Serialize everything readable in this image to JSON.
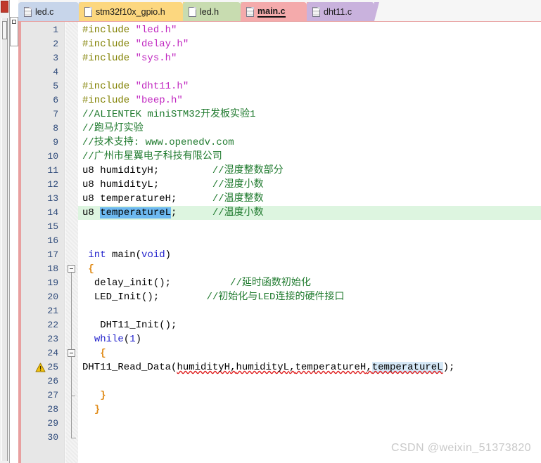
{
  "window": {
    "rail_button_color": "#c0392b",
    "accent_border_color": "#e8a0a0"
  },
  "tabs": [
    {
      "label": "led.c",
      "color": "#c7d5ea",
      "active": false,
      "icon": "file-lines-icon"
    },
    {
      "label": "stm32f10x_gpio.h",
      "color": "#fcd77f",
      "active": false,
      "icon": "file-blank-icon"
    },
    {
      "label": "led.h",
      "color": "#c8dcb0",
      "active": false,
      "icon": "file-blank-icon"
    },
    {
      "label": "main.c",
      "color": "#f4aaab",
      "active": true,
      "icon": "file-lines-icon"
    },
    {
      "label": "dht11.c",
      "color": "#c9b2dd",
      "active": false,
      "icon": "file-lines-icon"
    }
  ],
  "editor": {
    "current_line": 14,
    "selected_word": "temperatureL",
    "warning_line": 25,
    "warning_icon": "warning-triangle-icon",
    "colors": {
      "preprocessor": "#808000",
      "string": "#c026c0",
      "comment": "#1f7a2e",
      "keyword": "#2323cc",
      "brace": "#e08a16",
      "line_number": "#2e4a7a",
      "current_line_bg": "#ddf5e0",
      "selection_bg": "#6db9f0",
      "word_highlight_bg": "#d5e8f7",
      "error_squiggle": "#e02020",
      "gutter_bg": "#e7e7e7"
    },
    "lines": [
      {
        "n": 1,
        "text": "#include \"led.h\""
      },
      {
        "n": 2,
        "text": "#include \"delay.h\""
      },
      {
        "n": 3,
        "text": "#include \"sys.h\""
      },
      {
        "n": 4,
        "text": ""
      },
      {
        "n": 5,
        "text": "#include \"dht11.h\""
      },
      {
        "n": 6,
        "text": "#include \"beep.h\""
      },
      {
        "n": 7,
        "text": "//ALIENTEK miniSTM32开发板实验1"
      },
      {
        "n": 8,
        "text": "//跑马灯实验"
      },
      {
        "n": 9,
        "text": "//技术支持: www.openedv.com"
      },
      {
        "n": 10,
        "text": "//广州市星翼电子科技有限公司"
      },
      {
        "n": 11,
        "text": "u8 humidityH;         //湿度整数部分"
      },
      {
        "n": 12,
        "text": "u8 humidityL;         //湿度小数"
      },
      {
        "n": 13,
        "text": "u8 temperatureH;      //温度整数"
      },
      {
        "n": 14,
        "text": "u8 temperatureL;      //温度小数"
      },
      {
        "n": 15,
        "text": ""
      },
      {
        "n": 16,
        "text": ""
      },
      {
        "n": 17,
        "text": " int main(void)"
      },
      {
        "n": 18,
        "text": " {"
      },
      {
        "n": 19,
        "text": "  delay_init();          //延时函数初始化"
      },
      {
        "n": 20,
        "text": "  LED_Init();        //初始化与LED连接的硬件接口"
      },
      {
        "n": 21,
        "text": ""
      },
      {
        "n": 22,
        "text": "   DHT11_Init();"
      },
      {
        "n": 23,
        "text": "  while(1)"
      },
      {
        "n": 24,
        "text": "   {"
      },
      {
        "n": 25,
        "text": "DHT11_Read_Data(humidityH,humidityL,temperatureH,temperatureL);"
      },
      {
        "n": 26,
        "text": ""
      },
      {
        "n": 27,
        "text": "   }"
      },
      {
        "n": 28,
        "text": "  }"
      },
      {
        "n": 29,
        "text": ""
      },
      {
        "n": 30,
        "text": ""
      }
    ]
  },
  "watermark": {
    "text": "CSDN @weixin_51373820"
  }
}
